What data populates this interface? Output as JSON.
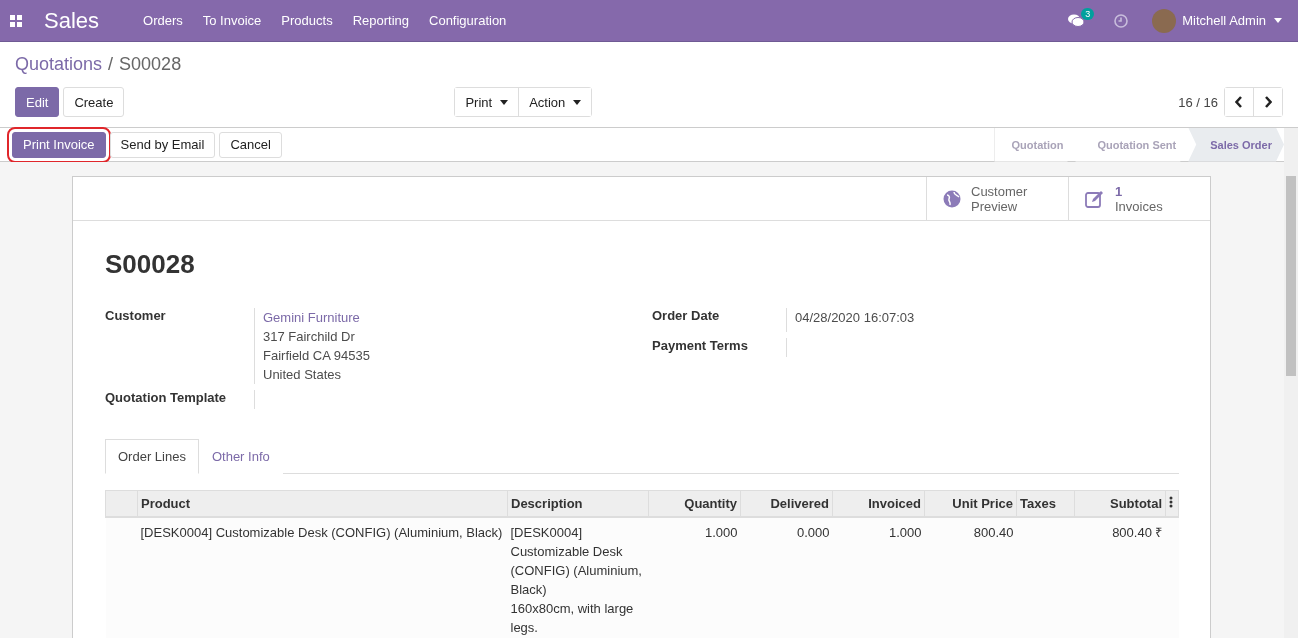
{
  "navbar": {
    "app_title": "Sales",
    "menu": [
      "Orders",
      "To Invoice",
      "Products",
      "Reporting",
      "Configuration"
    ],
    "messages_badge": "3",
    "user": "Mitchell Admin"
  },
  "breadcrumb": {
    "parent": "Quotations",
    "separator": "/",
    "current": "S00028"
  },
  "control_buttons": [
    {
      "label": "Edit",
      "kind": "primary"
    },
    {
      "label": "Create",
      "kind": "secondary"
    }
  ],
  "dropdowns": [
    "Print",
    "Action"
  ],
  "pager": "16 / 16",
  "header_buttons": [
    {
      "label": "Print Invoice",
      "kind": "primary",
      "highlighted": true
    },
    {
      "label": "Send by Email",
      "kind": "secondary",
      "highlighted": false
    },
    {
      "label": "Cancel",
      "kind": "secondary",
      "highlighted": false
    }
  ],
  "statusbar": [
    {
      "label": "Quotation",
      "selected": false
    },
    {
      "label": "Quotation Sent",
      "selected": false
    },
    {
      "label": "Sales Order",
      "selected": true
    }
  ],
  "smart_buttons": [
    {
      "kind": "globe",
      "label": "Customer",
      "label2": "Preview"
    },
    {
      "kind": "edit",
      "count": "1",
      "label": "Invoices"
    }
  ],
  "title": "S00028",
  "left_fields": [
    {
      "label": "Customer",
      "link": "Gemini Furniture",
      "lines": [
        "317 Fairchild Dr",
        "Fairfield CA 94535",
        "United States"
      ]
    },
    {
      "label": "Quotation Template"
    }
  ],
  "right_fields": [
    {
      "label": "Order Date",
      "lines": [
        "04/28/2020 16:07:03"
      ]
    },
    {
      "label": "Payment Terms"
    }
  ],
  "tabs": [
    {
      "label": "Order Lines",
      "selected": true
    },
    {
      "label": "Other Info",
      "selected": false
    }
  ],
  "table": {
    "columns": [
      "Product",
      "Description",
      "Quantity",
      "Delivered",
      "Invoiced",
      "Unit Price",
      "Taxes",
      "Subtotal"
    ],
    "rows": [
      {
        "cells": [
          "[DESK0004] Customizable Desk (CONFIG) (Aluminium, Black)",
          "[DESK0004]\nCustomizable Desk (CONFIG) (Aluminium, Black)\n160x80cm, with large legs.",
          "1.000",
          "0.000",
          "1.000",
          "800.40",
          "",
          "800.40 ₹"
        ]
      }
    ]
  }
}
